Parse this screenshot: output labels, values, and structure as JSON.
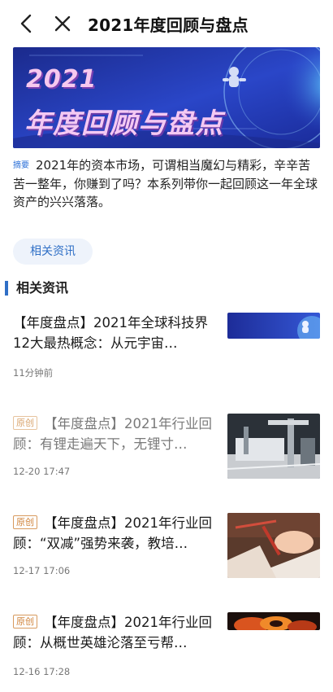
{
  "header": {
    "title": "2021年度回顾与盘点"
  },
  "banner": {
    "year": "2021",
    "title": "年度回顾与盘点"
  },
  "summary": {
    "tag": "摘要",
    "text": "2021年的资本市场，可谓相当魔幻与精彩，辛辛苦苦一整年，你赚到了吗？本系列带你一起回顾这一年全球资产的兴兴落落。"
  },
  "chip": {
    "label": "相关资讯"
  },
  "section": {
    "title": "相关资讯"
  },
  "articles": [
    {
      "badge": "",
      "title": "【年度盘点】2021年全球科技界12大最热概念：从元宇宙…",
      "time": "11分钟前"
    },
    {
      "badge": "原创",
      "title": "【年度盘点】2021年行业回顾：有锂走遍天下，无锂寸…",
      "time": "12-20 17:47"
    },
    {
      "badge": "原创",
      "title": "【年度盘点】2021年行业回顾：“双减”强势来袭，教培…",
      "time": "12-17 17:06"
    },
    {
      "badge": "原创",
      "title": "【年度盘点】2021年行业回顾：从概世英雄沦落至亏帮…",
      "time": "12-16 17:28"
    }
  ],
  "colors": {
    "accent": "#2f6fc6",
    "badge": "#d0833a"
  },
  "icons": {
    "back": "chevron-left-icon",
    "close": "close-icon"
  }
}
